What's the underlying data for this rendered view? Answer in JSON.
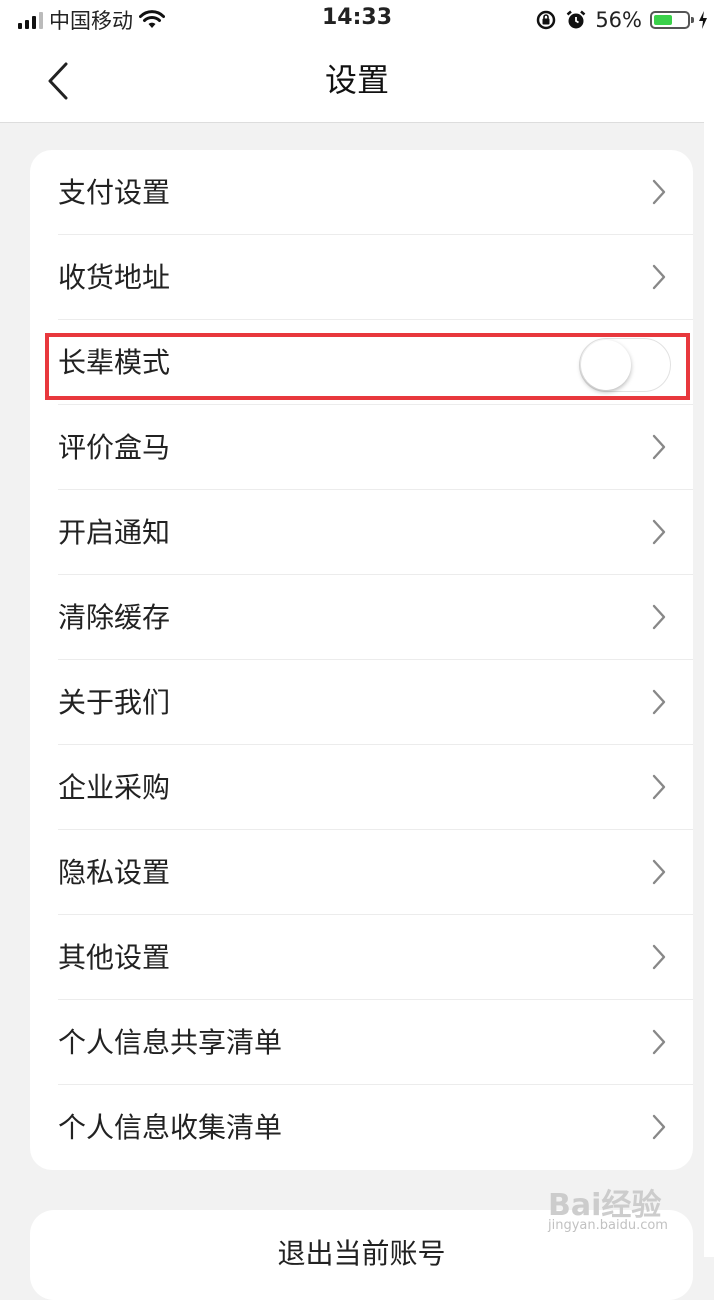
{
  "status_bar": {
    "carrier": "中国移动",
    "time": "14:33",
    "battery_percent": "56%",
    "battery_level": 0.56,
    "battery_color": "#3ad14a",
    "icons": [
      "signal-icon",
      "wifi-icon",
      "orientation-lock-icon",
      "alarm-icon",
      "battery-icon",
      "charging-icon"
    ]
  },
  "nav": {
    "title": "设置",
    "back_icon": "chevron-left-icon"
  },
  "settings": {
    "items": [
      {
        "label": "支付设置",
        "type": "link"
      },
      {
        "label": "收货地址",
        "type": "link"
      },
      {
        "label": "长辈模式",
        "type": "toggle",
        "toggled": false
      },
      {
        "label": "评价盒马",
        "type": "link"
      },
      {
        "label": "开启通知",
        "type": "link"
      },
      {
        "label": "清除缓存",
        "type": "link"
      },
      {
        "label": "关于我们",
        "type": "link"
      },
      {
        "label": "企业采购",
        "type": "link"
      },
      {
        "label": "隐私设置",
        "type": "link"
      },
      {
        "label": "其他设置",
        "type": "link"
      },
      {
        "label": "个人信息共享清单",
        "type": "link"
      },
      {
        "label": "个人信息收集清单",
        "type": "link"
      }
    ]
  },
  "logout": {
    "label": "退出当前账号"
  },
  "highlight_color": "#e8383d",
  "watermark": {
    "logo": "Bai经验",
    "url": "jingyan.baidu.com"
  }
}
